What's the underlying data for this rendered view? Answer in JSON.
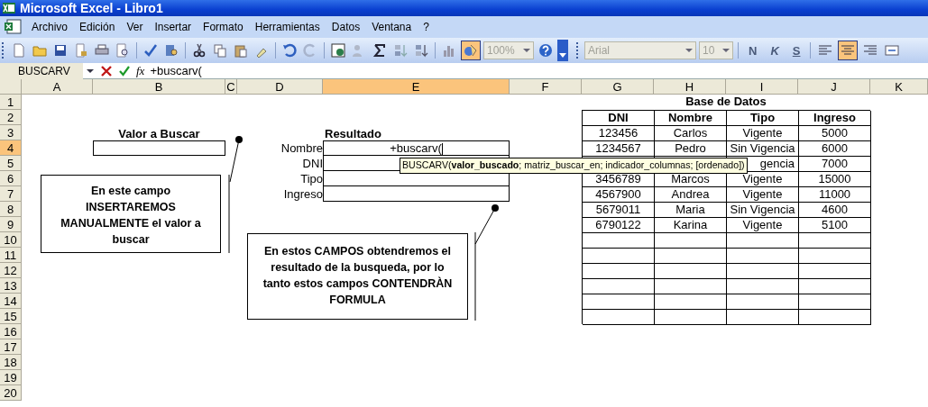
{
  "window": {
    "title": "Microsoft Excel - Libro1"
  },
  "menu": [
    "Archivo",
    "Edición",
    "Ver",
    "Insertar",
    "Formato",
    "Herramientas",
    "Datos",
    "Ventana",
    "?"
  ],
  "toolbar": {
    "drawing_on": true,
    "zoom": "100%",
    "font": "Arial",
    "font_size": "10",
    "styles": [
      "N",
      "K",
      "S"
    ],
    "alignments": [
      {
        "kind": "left",
        "selected": false
      },
      {
        "kind": "center",
        "selected": true
      },
      {
        "kind": "right",
        "selected": false
      }
    ]
  },
  "formula_bar": {
    "name_box": "BUSCARV",
    "function_label": "fx",
    "formula": "+buscarv("
  },
  "columns": [
    {
      "label": "A",
      "selected": false
    },
    {
      "label": "B",
      "selected": false
    },
    {
      "label": "C",
      "selected": false
    },
    {
      "label": "D",
      "selected": false
    },
    {
      "label": "E",
      "selected": true
    },
    {
      "label": "F",
      "selected": false
    },
    {
      "label": "G",
      "selected": false
    },
    {
      "label": "H",
      "selected": false
    },
    {
      "label": "I",
      "selected": false
    },
    {
      "label": "J",
      "selected": false
    },
    {
      "label": "K",
      "selected": false
    }
  ],
  "rows": [
    {
      "label": "1",
      "selected": false
    },
    {
      "label": "2",
      "selected": false
    },
    {
      "label": "3",
      "selected": false
    },
    {
      "label": "4",
      "selected": true
    },
    {
      "label": "5",
      "selected": false
    },
    {
      "label": "6",
      "selected": false
    },
    {
      "label": "7",
      "selected": false
    },
    {
      "label": "8",
      "selected": false
    },
    {
      "label": "9",
      "selected": false
    },
    {
      "label": "10",
      "selected": false
    },
    {
      "label": "11",
      "selected": false
    },
    {
      "label": "12",
      "selected": false
    },
    {
      "label": "13",
      "selected": false
    },
    {
      "label": "14",
      "selected": false
    },
    {
      "label": "15",
      "selected": false
    },
    {
      "label": "16",
      "selected": false
    },
    {
      "label": "17",
      "selected": false
    },
    {
      "label": "18",
      "selected": false
    },
    {
      "label": "19",
      "selected": false
    },
    {
      "label": "20",
      "selected": false
    }
  ],
  "search": {
    "title": "Valor a Buscar"
  },
  "result": {
    "title": "Resultado",
    "fields": [
      {
        "label": "Nombre",
        "value": "+buscarv("
      },
      {
        "label": "DNI"
      },
      {
        "label": "Tipo"
      },
      {
        "label": "Ingreso"
      }
    ]
  },
  "database": {
    "title": "Base de Datos",
    "columns": [
      "DNI",
      "Nombre",
      "Tipo",
      "Ingreso"
    ],
    "rows": [
      [
        "123456",
        "Carlos",
        "Vigente",
        "5000"
      ],
      [
        "1234567",
        "Pedro",
        "Sin Vigencia",
        "6000"
      ],
      [
        null,
        null,
        "gencia",
        "7000"
      ],
      [
        "3456789",
        "Marcos",
        "Vigente",
        "15000"
      ],
      [
        "4567900",
        "Andrea",
        "Vigente",
        "11000"
      ],
      [
        "5679011",
        "Maria",
        "Sin Vigencia",
        "4600"
      ],
      [
        "6790122",
        "Karina",
        "Vigente",
        "5100"
      ]
    ]
  },
  "notes": [
    "En este campo INSERTAREMOS MANUALMENTE el valor a buscar",
    "En estos CAMPOS obtendremos el resultado de la busqueda, por lo tanto estos campos CONTENDRÀN FORMULA"
  ],
  "tooltip": "BUSCARV(**valor_buscado**; matriz_buscar_en; indicador_columnas; [ordenado])"
}
